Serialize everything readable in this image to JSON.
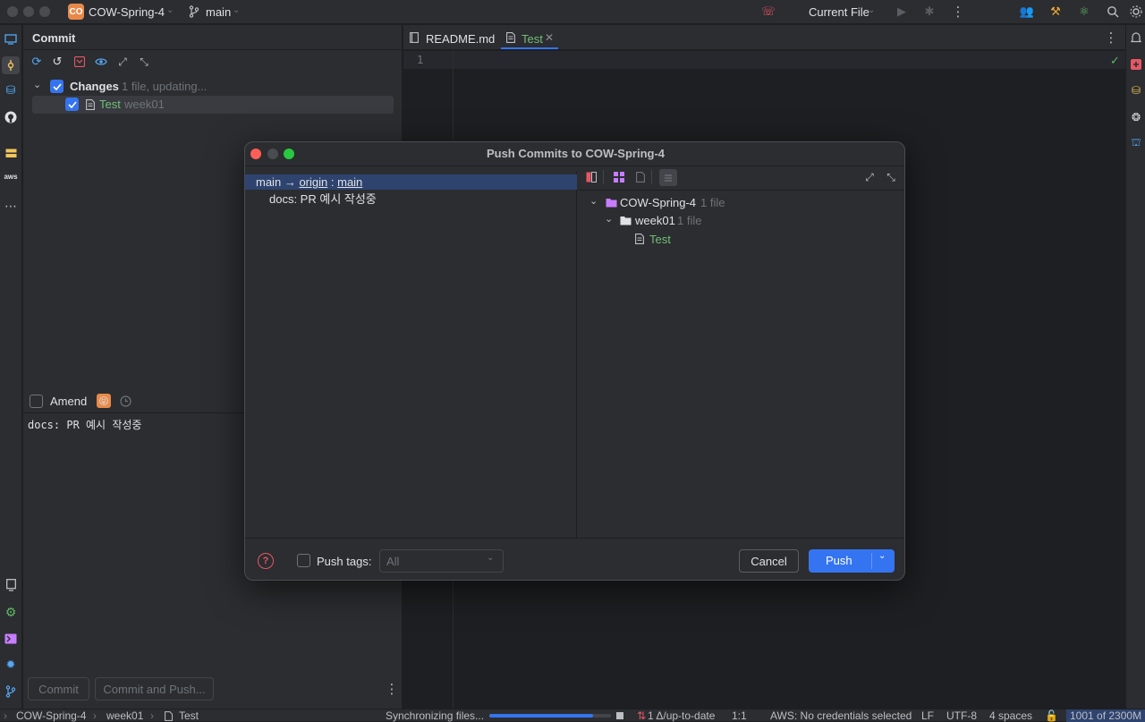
{
  "titlebar": {
    "project_badge": "CO",
    "project_name": "COW-Spring-4",
    "branch": "main",
    "run_config": "Current File"
  },
  "commit_panel": {
    "title": "Commit",
    "changes_label": "Changes",
    "changes_meta": "1 file, updating...",
    "file_name": "Test",
    "file_dir": "week01",
    "amend_label": "Amend",
    "commit_message": "docs: PR 예시 작성중",
    "commit_button": "Commit",
    "commit_push_button": "Commit and Push..."
  },
  "editor": {
    "tabs": [
      {
        "label": "README.md"
      },
      {
        "label": "Test"
      }
    ],
    "line_number": "1"
  },
  "dialog": {
    "title": "Push Commits to COW-Spring-4",
    "branch_local": "main",
    "arrow": "→",
    "remote": "origin",
    "sep": ":",
    "branch_remote": "main",
    "commit_subject": "docs: PR 예시 작성중",
    "tree": {
      "root_name": "COW-Spring-4",
      "root_meta": "1 file",
      "folder_name": "week01",
      "folder_meta": "1 file",
      "file_name": "Test"
    },
    "push_tags_label": "Push tags:",
    "push_tags_value": "All",
    "cancel_label": "Cancel",
    "push_label": "Push"
  },
  "statusbar": {
    "crumb_project": "COW-Spring-4",
    "crumb_folder": "week01",
    "crumb_file": "Test",
    "sync_text": "Synchronizing files...",
    "sync_progress": 0.85,
    "vcs_status": "1 Δ/up-to-date",
    "position": "1:1",
    "aws": "AWS: No credentials selected",
    "line_sep": "LF",
    "encoding": "UTF-8",
    "indent": "4 spaces",
    "memory": "1001 of 2300M"
  },
  "colors": {
    "accent": "#3574f0",
    "selection": "#2e436e",
    "green_file": "#73bd79",
    "folder_purple": "#c77dff"
  }
}
